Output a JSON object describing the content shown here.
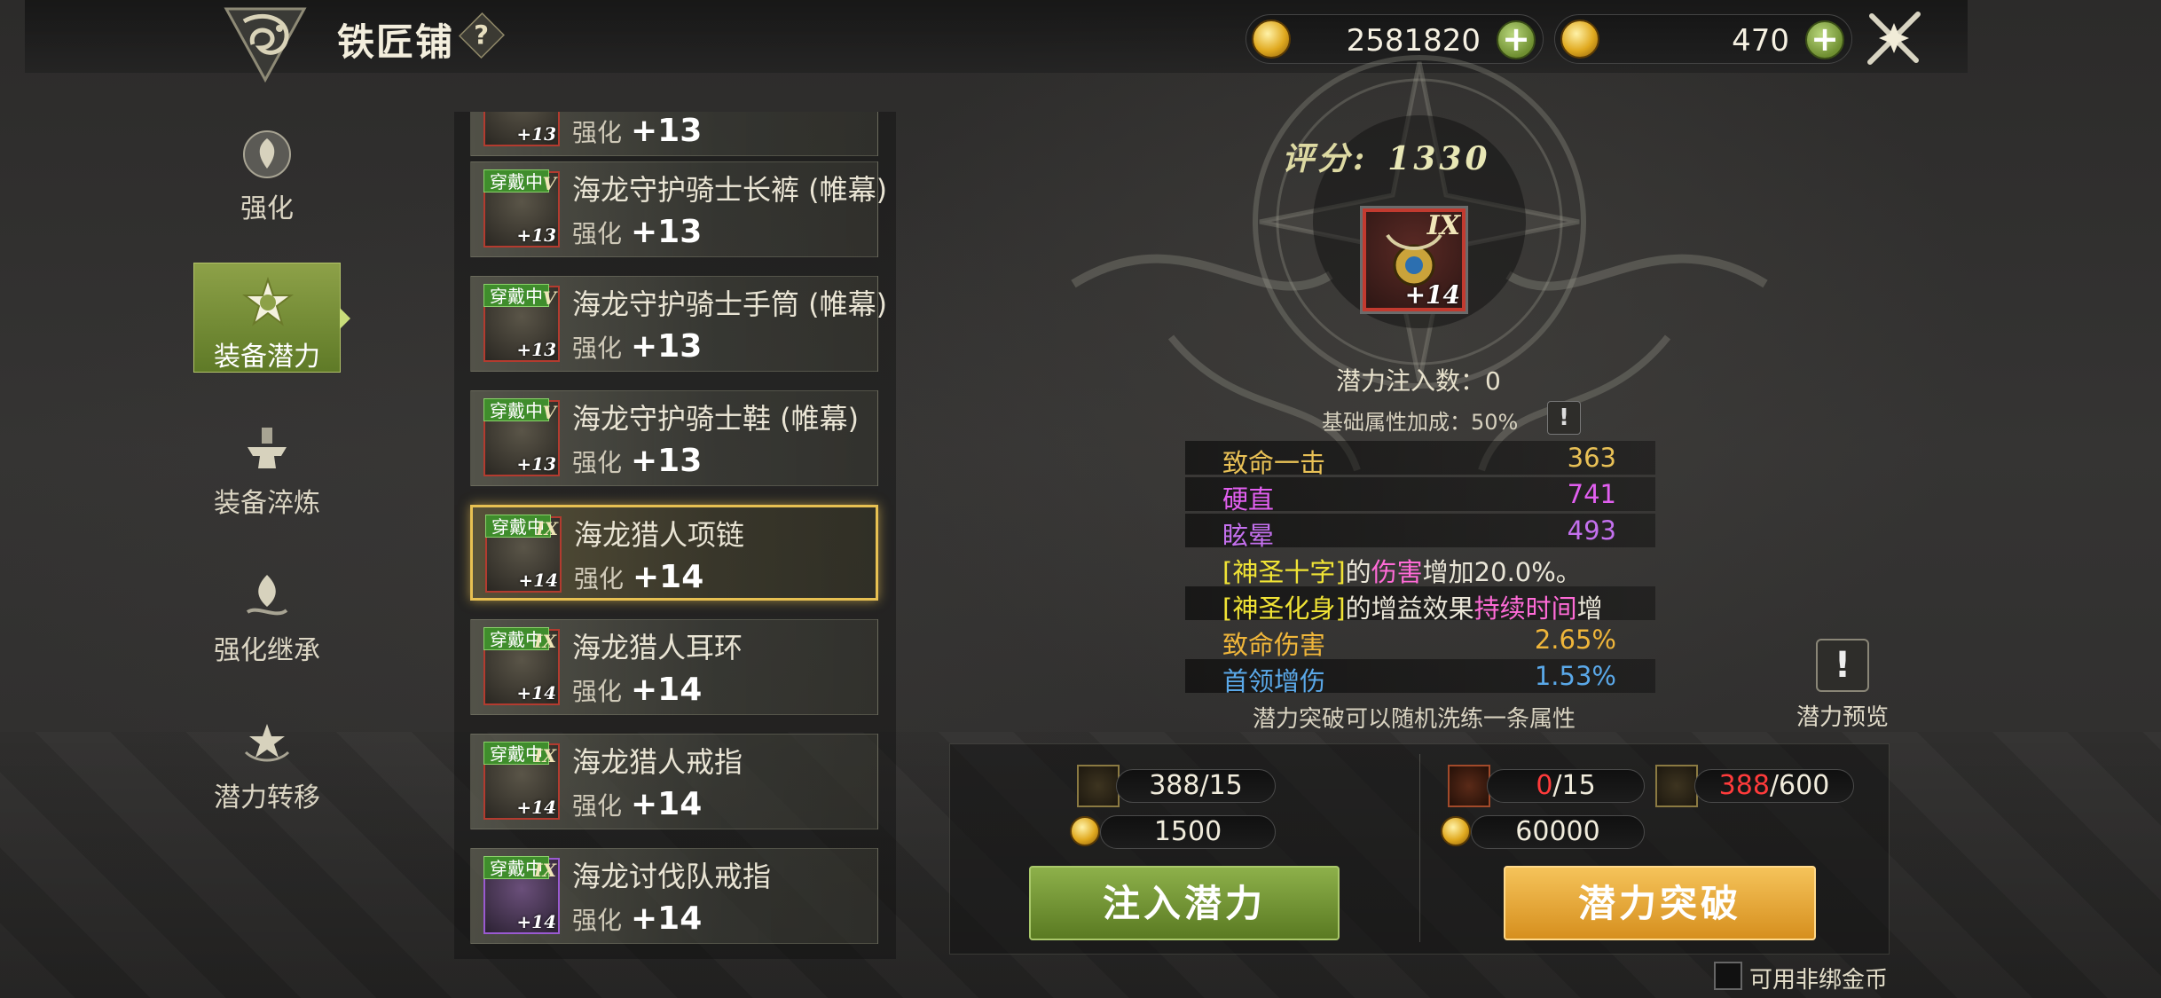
{
  "header": {
    "title": "铁匠铺",
    "help_label": "?"
  },
  "currencies": [
    {
      "icon": "gold-coin-bound-icon",
      "value": "2581820",
      "plus": "+"
    },
    {
      "icon": "gold-coin-icon",
      "value": "470",
      "plus": "+"
    }
  ],
  "nav": [
    {
      "label": "强化",
      "icon": "enhance-icon",
      "active": false
    },
    {
      "label": "装备潜力",
      "icon": "potential-icon",
      "active": true
    },
    {
      "label": "装备淬炼",
      "icon": "anvil-icon",
      "active": false
    },
    {
      "label": "强化继承",
      "icon": "inherit-icon",
      "active": false
    },
    {
      "label": "潜力转移",
      "icon": "transfer-icon",
      "active": false
    }
  ],
  "items": [
    {
      "name": "",
      "sub_label": "强化",
      "level": "+13",
      "badge": "",
      "roman": "",
      "icon_level": "+13",
      "rarity": "red"
    },
    {
      "name": "海龙守护骑士长裤 (帷幕)",
      "sub_label": "强化",
      "level": "+13",
      "badge": "穿戴中",
      "roman": "V",
      "icon_level": "+13",
      "rarity": "red"
    },
    {
      "name": "海龙守护骑士手筒 (帷幕)",
      "sub_label": "强化",
      "level": "+13",
      "badge": "穿戴中",
      "roman": "V",
      "icon_level": "+13",
      "rarity": "red"
    },
    {
      "name": "海龙守护骑士鞋 (帷幕)",
      "sub_label": "强化",
      "level": "+13",
      "badge": "穿戴中",
      "roman": "V",
      "icon_level": "+13",
      "rarity": "red"
    },
    {
      "name": "海龙猎人项链",
      "sub_label": "强化",
      "level": "+14",
      "badge": "穿戴中",
      "roman": "IX",
      "icon_level": "+14",
      "rarity": "red",
      "selected": true
    },
    {
      "name": "海龙猎人耳环",
      "sub_label": "强化",
      "level": "+14",
      "badge": "穿戴中",
      "roman": "IX",
      "icon_level": "+14",
      "rarity": "red"
    },
    {
      "name": "海龙猎人戒指",
      "sub_label": "强化",
      "level": "+14",
      "badge": "穿戴中",
      "roman": "IX",
      "icon_level": "+14",
      "rarity": "red"
    },
    {
      "name": "海龙讨伐队戒指",
      "sub_label": "强化",
      "level": "+14",
      "badge": "穿戴中",
      "roman": "IX",
      "icon_level": "+14",
      "rarity": "purple"
    }
  ],
  "detail": {
    "score_label": "评分:",
    "score_value": "1330",
    "item_roman": "IX",
    "item_level": "+14",
    "inject_count": "潜力注入数：0",
    "base_bonus": "基础属性加成：50%",
    "info_label": "!",
    "stats": [
      {
        "name": "致命一击",
        "value": "363"
      },
      {
        "name": "硬直",
        "value": "741"
      },
      {
        "name": "眩晕",
        "value": "493"
      }
    ],
    "text_lines": [
      {
        "parts": [
          "[神圣十字]",
          "的",
          "伤害",
          "增加20.0%。"
        ]
      },
      {
        "parts": [
          "[神圣化身]",
          "的增益效果",
          "持续时间",
          "增"
        ]
      }
    ],
    "extra_stats": [
      {
        "name": "致命伤害",
        "value": "2.65%"
      },
      {
        "name": "首领增伤",
        "value": "1.53%"
      }
    ],
    "footer": "潜力突破可以随机洗练一条属性",
    "preview_label": "潜力预览",
    "preview_icon": "!"
  },
  "inject": {
    "material_count": "388/15",
    "gold_cost": "1500",
    "button_label": "注入潜力"
  },
  "breakthrough": {
    "material1_have": "0",
    "material1_need": "/15",
    "material2_have": "388",
    "material2_need": "/600",
    "gold_cost": "60000",
    "button_label": "潜力突破"
  },
  "options": {
    "use_unbound_gold": "可用非绑金币"
  },
  "colors": {
    "accent_green": "#8da148",
    "gold_button": "#f0b63a",
    "selected_border": "#e7c052",
    "badge_green": "#3f8d2c"
  }
}
